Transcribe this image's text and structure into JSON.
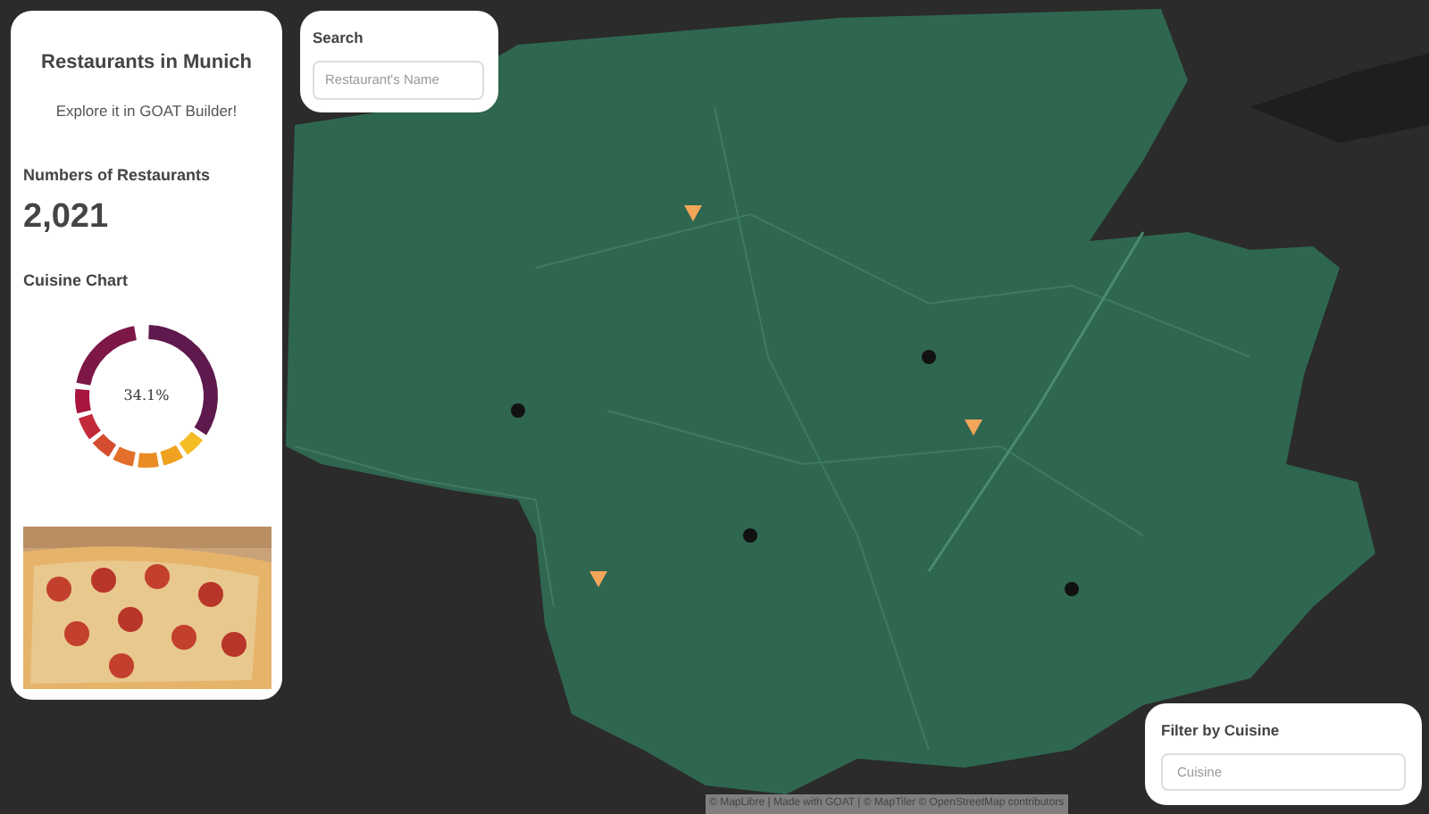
{
  "overview": {
    "title": "Restaurants in Munich",
    "subtitle": "Explore it in GOAT Builder!",
    "count_label": "Numbers of Restaurants",
    "count": "2,021",
    "chart_title": "Cuisine Chart",
    "chart_center_label": "34.1%"
  },
  "search": {
    "label": "Search",
    "placeholder": "Restaurant's Name"
  },
  "cuisine_filter": {
    "label": "Filter by Cuisine",
    "placeholder": "Cuisine"
  },
  "map": {
    "attribution": "© MapLibre | Made with GOAT | © MapTiler © OpenStreetMap contributors"
  }
}
